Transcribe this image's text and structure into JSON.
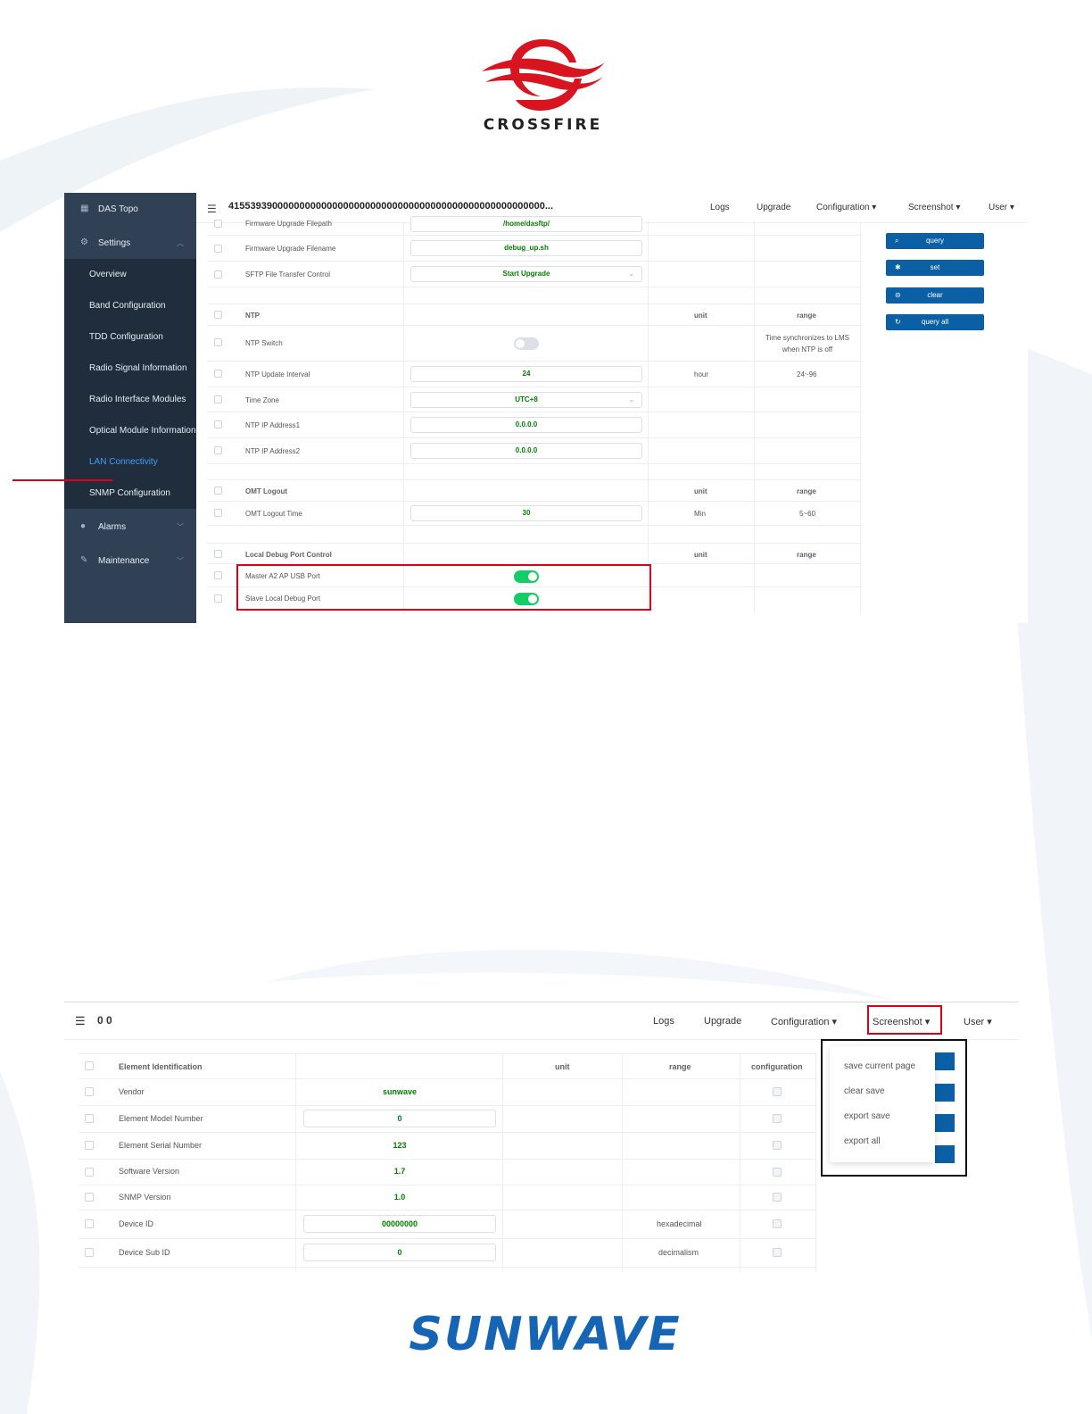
{
  "logos": {
    "top_brand": "CROSSFIRE",
    "bottom_brand": "SUNWAVE"
  },
  "colors": {
    "sidebar_bg": "#304156",
    "sidebar_sub_bg": "#1f2d3d",
    "active_link": "#409eff",
    "button_blue": "#0b5fa5",
    "value_green": "#008000",
    "toggle_on": "#13ce66",
    "highlight_red": "#d9001b",
    "crossfire_red": "#d7141f",
    "sunwave_blue": "#1565b4"
  },
  "shot1": {
    "sidebar": {
      "das_topo": "DAS Topo",
      "settings": "Settings",
      "sub_items": [
        "Overview",
        "Band Configuration",
        "TDD Configuration",
        "Radio Signal Information",
        "Radio Interface Modules",
        "Optical Module Information",
        "LAN Connectivity",
        "SNMP Configuration"
      ],
      "active_item": "LAN Connectivity",
      "alarms": "Alarms",
      "maintenance": "Maintenance"
    },
    "header": {
      "device_id": "4155393900000000000000000000000000000000000000000000000000...",
      "nav": [
        "Logs",
        "Upgrade",
        "Configuration ▾",
        "Screenshot ▾",
        "User ▾"
      ]
    },
    "upgrade_section": {
      "filepath_label": "Firmware Upgrade Filepath",
      "filepath_value": "/home/dasftp/",
      "filename_label": "Firmware Upgrade Filename",
      "filename_value": "debug_up.sh",
      "sftp_label": "SFTP File Transfer Control",
      "sftp_value": "Start Upgrade"
    },
    "ntp_section": {
      "header": "NTP",
      "unit_header": "unit",
      "range_header": "range",
      "switch_label": "NTP Switch",
      "switch_on": false,
      "switch_note_line1": "Time synchronizes to LMS",
      "switch_note_line2": "when NTP is off",
      "interval_label": "NTP Update Interval",
      "interval_value": "24",
      "interval_unit": "hour",
      "interval_range": "24~96",
      "tz_label": "Time Zone",
      "tz_value": "UTC+8",
      "ip1_label": "NTP IP Address1",
      "ip1_value": "0.0.0.0",
      "ip2_label": "NTP IP Address2",
      "ip2_value": "0.0.0.0"
    },
    "omt_section": {
      "header": "OMT Logout",
      "unit_header": "unit",
      "range_header": "range",
      "time_label": "OMT Logout Time",
      "time_value": "30",
      "time_unit": "Min",
      "time_range": "5~60"
    },
    "debug_section": {
      "header": "Local Debug Port Control",
      "unit_header": "unit",
      "range_header": "range",
      "master_label": "Master A2 AP USB Port",
      "master_on": true,
      "slave_label": "Slave Local Debug Port",
      "slave_on": true
    },
    "buttons": {
      "query": "query",
      "set": "set",
      "clear": "clear",
      "query_all": "query all"
    }
  },
  "shot2": {
    "header": {
      "device_id": "0 0",
      "nav": [
        "Logs",
        "Upgrade",
        "Configuration ▾",
        "Screenshot ▾",
        "User ▾"
      ]
    },
    "table": {
      "headers": [
        "Element Identification",
        "unit",
        "range",
        "configuration"
      ],
      "rows": [
        {
          "label": "Vendor",
          "value": "sunwave",
          "input": false,
          "range": ""
        },
        {
          "label": "Element Model Number",
          "value": "0",
          "input": true,
          "range": ""
        },
        {
          "label": "Element Serial Number",
          "value": "123",
          "input": false,
          "range": ""
        },
        {
          "label": "Software Version",
          "value": "1.7",
          "input": false,
          "range": ""
        },
        {
          "label": "SNMP Version",
          "value": "1.0",
          "input": false,
          "range": ""
        },
        {
          "label": "Device ID",
          "value": "00000000",
          "input": true,
          "range": "hexadecimal"
        },
        {
          "label": "Device Sub ID",
          "value": "0",
          "input": true,
          "range": "decimalism"
        }
      ]
    },
    "screenshot_menu": [
      "save current page",
      "clear save",
      "export save",
      "export all"
    ]
  }
}
